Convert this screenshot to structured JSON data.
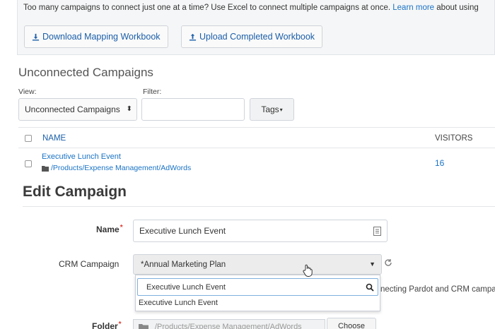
{
  "info": {
    "text_before": "Too many campaigns to connect just one at a time? Use Excel to connect multiple campaigns at once.",
    "link": "Learn more",
    "text_after": "about using"
  },
  "buttons": {
    "download": "Download Mapping Workbook",
    "upload": "Upload Completed Workbook"
  },
  "unconnected": {
    "title": "Unconnected Campaigns",
    "view_label": "View:",
    "view_value": "Unconnected Campaigns",
    "filter_label": "Filter:",
    "filter_value": "",
    "tags_label": "Tags"
  },
  "table": {
    "columns": {
      "name": "NAME",
      "visitors": "VISITORS"
    },
    "rows": [
      {
        "name": "Executive Lunch Event",
        "path": "/Products/Expense Management/AdWords",
        "visitors": "16"
      }
    ]
  },
  "edit": {
    "title": "Edit Campaign",
    "name_label": "Name",
    "name_value": "Executive Lunch Event",
    "crm_label": "CRM Campaign",
    "crm_value": "*Annual Marketing Plan",
    "dropdown_search": "Executive Lunch Event",
    "dropdown_option": "Executive Lunch Event",
    "side_text": "necting Pardot and CRM campa",
    "folder_label": "Folder",
    "folder_value": "/Products/Expense Management/AdWords",
    "choose_label": "Choose"
  },
  "colors": {
    "link": "#1a73c5",
    "required": "#e03a2f"
  }
}
